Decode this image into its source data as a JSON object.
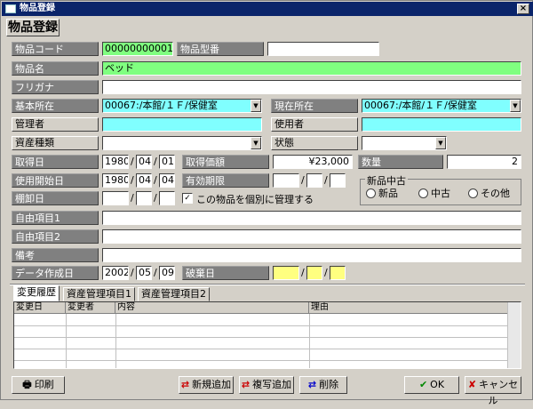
{
  "window": {
    "title": "物品登録",
    "close": "×"
  },
  "header": "物品登録",
  "labels": {
    "code": "物品コード",
    "model": "物品型番",
    "name": "物品名",
    "kana": "フリガナ",
    "base_loc": "基本所在",
    "cur_loc": "現在所在",
    "manager": "管理者",
    "user": "使用者",
    "asset_type": "資産種類",
    "state": "状態",
    "acq_date": "取得日",
    "acq_price": "取得価額",
    "qty": "数量",
    "use_start": "使用開始日",
    "expiry": "有効期限",
    "inventory": "棚卸日",
    "free1": "自由項目1",
    "free2": "自由項目2",
    "notes": "備考",
    "created": "データ作成日",
    "disposed": "破棄日"
  },
  "values": {
    "code": "0000000000164",
    "model": "",
    "name": "ベッド",
    "kana": "",
    "base_loc": "00067:/本館/１Ｆ/保健室",
    "cur_loc": "00067:/本館/１Ｆ/保健室",
    "manager": "",
    "user": "",
    "asset_type": "",
    "state": "",
    "acq_y": "1980",
    "acq_m": "04",
    "acq_d": "01",
    "acq_price": "¥23,000",
    "qty": "2",
    "use_y": "1980",
    "use_m": "04",
    "use_d": "04",
    "exp_y": "",
    "exp_m": "",
    "exp_d": "",
    "inv_y": "",
    "inv_m": "",
    "inv_d": "",
    "free1": "",
    "free2": "",
    "notes": "",
    "cr_y": "2002",
    "cr_m": "05",
    "cr_d": "09",
    "dis_y": "",
    "dis_m": "",
    "dis_d": ""
  },
  "individual_check": {
    "label": "この物品を個別に管理する",
    "checked": true
  },
  "condition": {
    "title": "新品中古",
    "options": [
      "新品",
      "中古",
      "その他"
    ]
  },
  "tabs": [
    "変更履歴",
    "資産管理項目1",
    "資産管理項目2"
  ],
  "grid": {
    "columns": [
      "変更日",
      "変更者",
      "内容",
      "理由"
    ],
    "rows": []
  },
  "buttons": {
    "print": "印刷",
    "new": "新規追加",
    "copy": "複写追加",
    "delete": "削除",
    "ok": "OK",
    "cancel": "キャンセル"
  },
  "date_sep": "/"
}
